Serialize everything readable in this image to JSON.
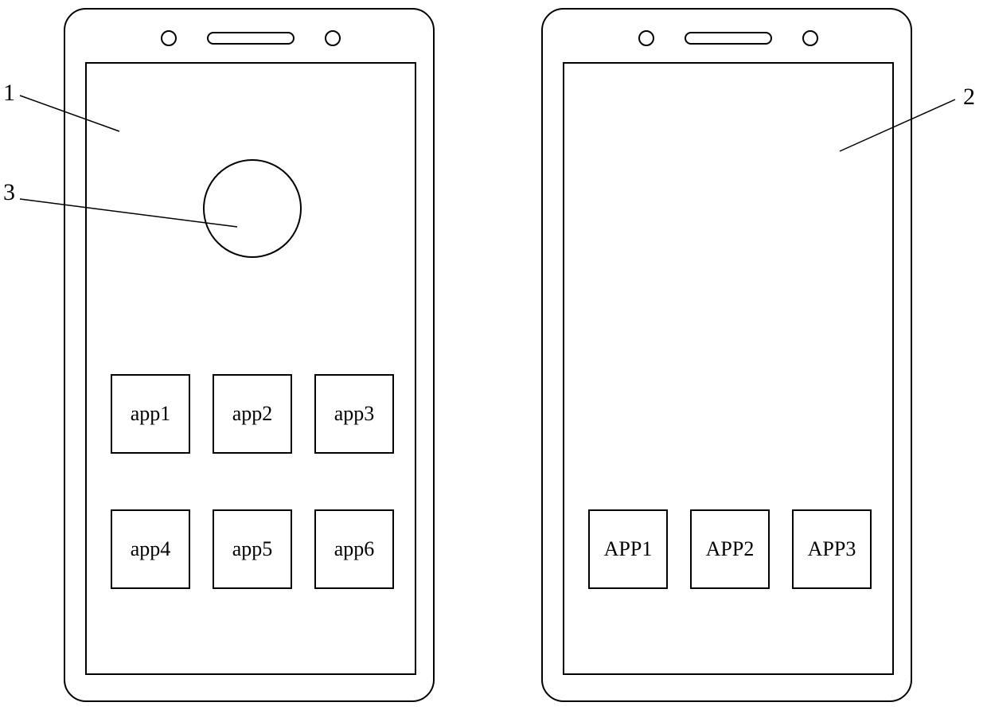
{
  "callouts": {
    "c1": "1",
    "c2": "2",
    "c3": "3"
  },
  "phoneA": {
    "apps": [
      "app1",
      "app2",
      "app3",
      "app4",
      "app5",
      "app6"
    ]
  },
  "phoneB": {
    "apps": [
      "APP1",
      "APP2",
      "APP3"
    ]
  }
}
